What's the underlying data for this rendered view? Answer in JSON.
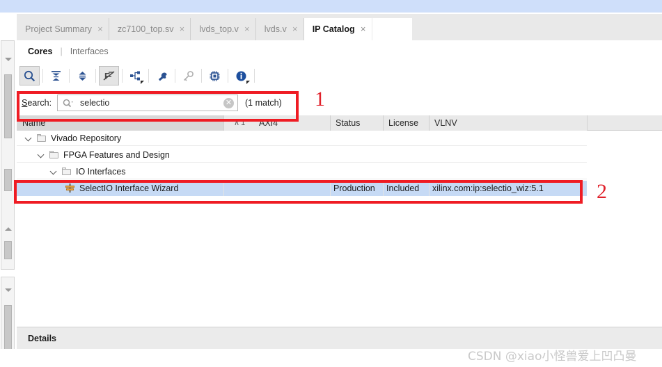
{
  "window": {
    "tabs": [
      {
        "label": "Project Summary",
        "close": "×",
        "active": false
      },
      {
        "label": "zc7100_top.sv",
        "close": "×",
        "active": false
      },
      {
        "label": "lvds_top.v",
        "close": "×",
        "active": false
      },
      {
        "label": "lvds.v",
        "close": "×",
        "active": false
      },
      {
        "label": "IP Catalog",
        "close": "×",
        "active": true
      }
    ]
  },
  "subtabs": {
    "selected": "Cores",
    "separator": "|",
    "other": "Interfaces"
  },
  "toolbar": {
    "buttons": [
      {
        "name": "search-icon",
        "title": "Search"
      },
      {
        "name": "collapse-all-icon",
        "title": "Collapse All"
      },
      {
        "name": "expand-all-icon",
        "title": "Expand All"
      },
      {
        "name": "sort-disabled-icon",
        "title": "Disable Sorting"
      },
      {
        "name": "hierarchy-icon",
        "title": "Group by"
      },
      {
        "name": "wrench-icon",
        "title": "Settings"
      },
      {
        "name": "key-icon",
        "title": "Licenses"
      },
      {
        "name": "chip-icon",
        "title": "IP Settings"
      },
      {
        "name": "info-icon",
        "title": "Information"
      }
    ]
  },
  "search": {
    "label_prefix": "S",
    "label_rest": "earch:",
    "value": "selectio",
    "placeholder": "Search",
    "clear": "✕",
    "match_count": "(1 match)"
  },
  "table": {
    "columns": [
      {
        "key": "name",
        "label": "Name",
        "sort_indicator": "∧ 1"
      },
      {
        "key": "axi4",
        "label": "AXI4"
      },
      {
        "key": "status",
        "label": "Status"
      },
      {
        "key": "license",
        "label": "License"
      },
      {
        "key": "vlnv",
        "label": "VLNV"
      }
    ],
    "rows": [
      {
        "type": "folder",
        "depth": 0,
        "name": "Vivado Repository",
        "expanded": true,
        "axi4": "",
        "status": "",
        "license": "",
        "vlnv": "",
        "selected": false
      },
      {
        "type": "folder",
        "depth": 1,
        "name": "FPGA Features and Design",
        "expanded": true,
        "axi4": "",
        "status": "",
        "license": "",
        "vlnv": "",
        "selected": false
      },
      {
        "type": "folder",
        "depth": 2,
        "name": "IO Interfaces",
        "expanded": true,
        "axi4": "",
        "status": "",
        "license": "",
        "vlnv": "",
        "selected": false
      },
      {
        "type": "ip",
        "depth": 3,
        "name": "SelectIO Interface Wizard",
        "expanded": false,
        "axi4": "",
        "status": "Production",
        "license": "Included",
        "vlnv": "xilinx.com:ip:selectio_wiz:5.1",
        "selected": true
      }
    ]
  },
  "details": {
    "label": "Details"
  },
  "annotations": [
    {
      "id": "1",
      "label": "1",
      "target": "search-row"
    },
    {
      "id": "2",
      "label": "2",
      "target": "selected-ip-row"
    }
  ],
  "watermark": {
    "text": "CSDN @xiao小怪兽爱上凹凸曼"
  },
  "colors": {
    "annotation_red": "#ef1c24",
    "selection_blue": "#c6daf5",
    "top_band": "#cfdffa",
    "icon_blue": "#2b5292"
  }
}
